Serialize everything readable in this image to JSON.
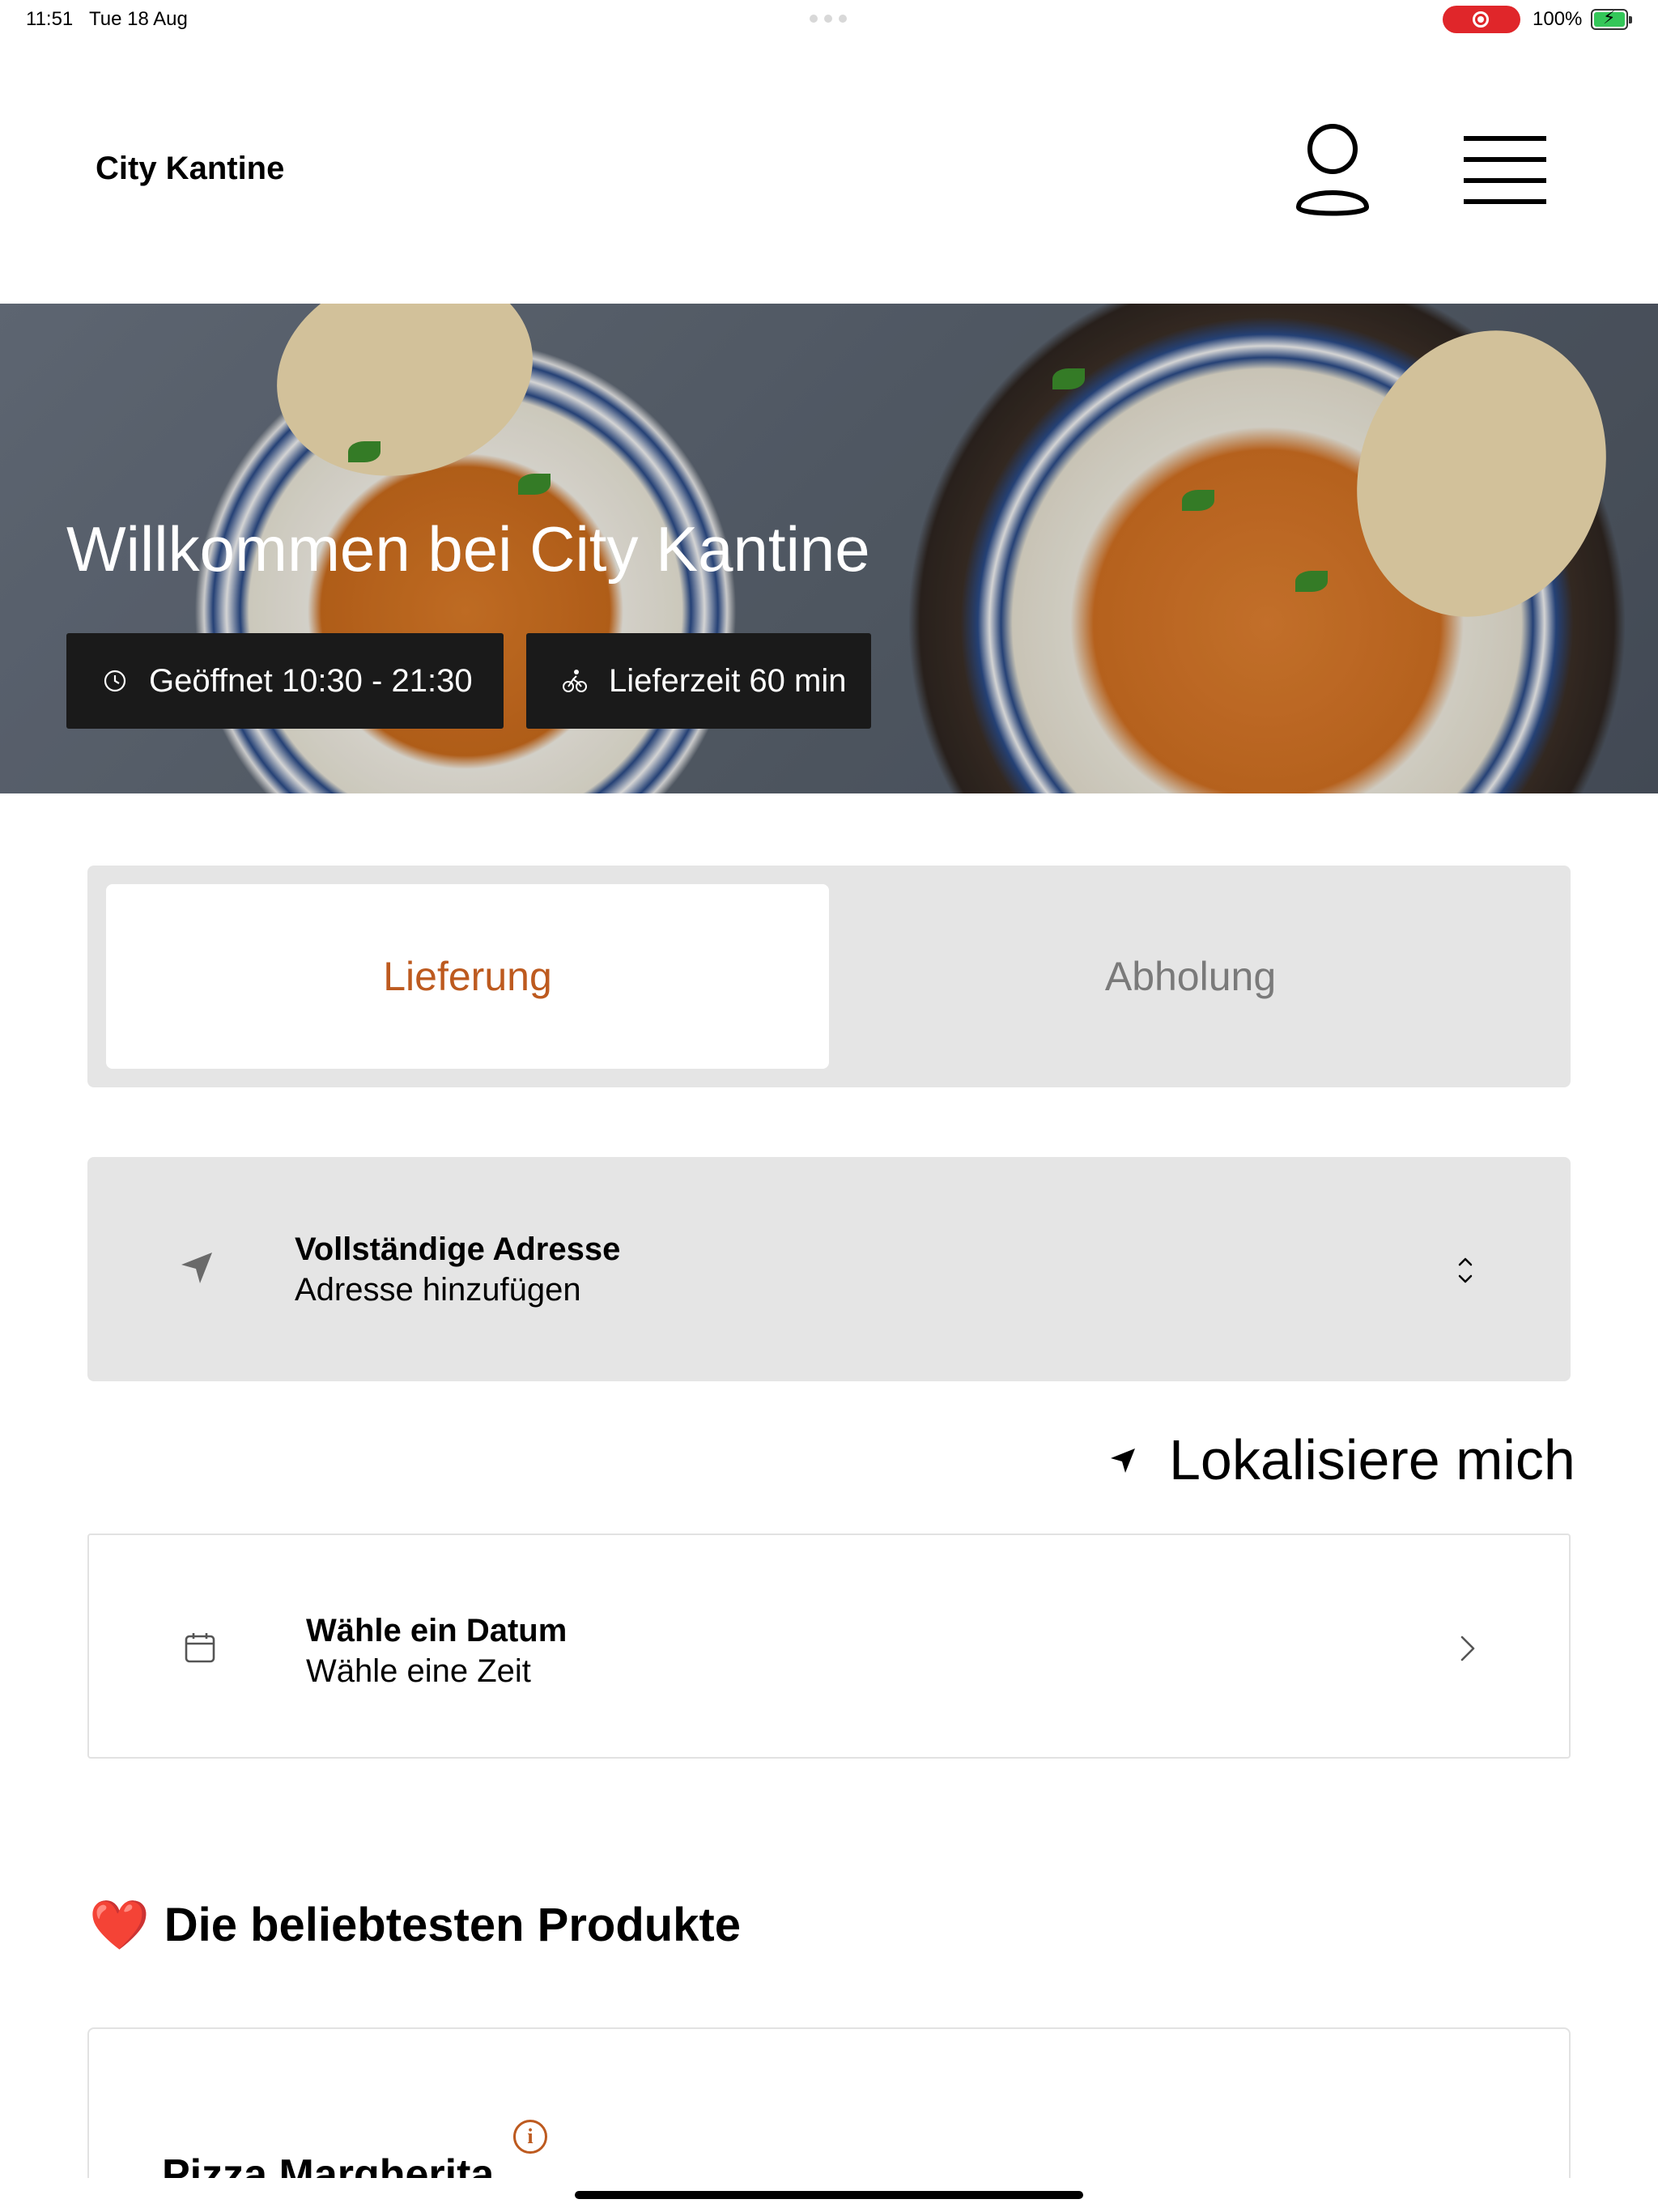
{
  "status_bar": {
    "time": "11:51",
    "date": "Tue 18 Aug",
    "battery": "100%",
    "record_color": "#e0262a",
    "battery_color": "#34c759"
  },
  "header": {
    "title": "City Kantine",
    "profile_icon": "person-icon",
    "menu_icon": "hamburger-icon"
  },
  "hero": {
    "title": "Willkommen bei City Kantine",
    "hours_label": "Geöffnet 10:30 - 21:30",
    "delivery_time_label": "Lieferzeit 60 min",
    "hours_icon": "clock-icon",
    "delivery_icon": "bike-icon"
  },
  "tabs": {
    "items": [
      {
        "label": "Lieferung",
        "selected": true
      },
      {
        "label": "Abholung",
        "selected": false
      }
    ],
    "accent_color": "#bd5a1f"
  },
  "address": {
    "title": "Vollständige Adresse",
    "subtitle": "Adresse hinzufügen",
    "icon": "location-arrow-icon"
  },
  "locate": {
    "label": "Lokalisiere mich",
    "icon": "location-arrow-icon"
  },
  "schedule": {
    "title": "Wähle ein Datum",
    "subtitle": "Wähle eine Zeit",
    "icon": "calendar-icon"
  },
  "popular": {
    "heading": "Die beliebtesten Produkte",
    "emoji": "❤️",
    "products": [
      {
        "name": "Pizza Margherita"
      }
    ]
  }
}
